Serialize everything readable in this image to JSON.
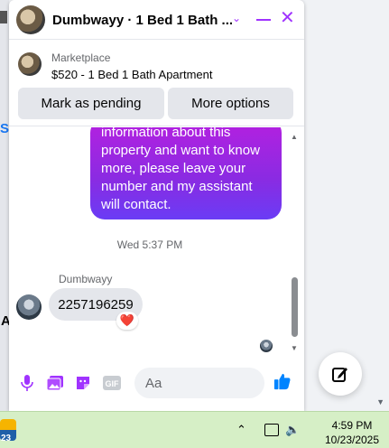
{
  "chat": {
    "title": "Dumbwayy · 1 Bed 1 Bath ...",
    "marketplace_label": "Marketplace",
    "listing_title": "$520 - 1 Bed 1 Bath Apartment",
    "mark_pending_label": "Mark as pending",
    "more_options_label": "More options"
  },
  "conversation": {
    "outgoing_text": "information about this property and want to know more, please leave your number and my assistant will contact.",
    "timestamp": "Wed 5:37 PM",
    "sender_name": "Dumbwayy",
    "incoming_text": "2257196259",
    "reaction": "❤️"
  },
  "composer": {
    "placeholder": "Aa",
    "gif_label": "GIF"
  },
  "background": {
    "left_text_s": "S",
    "left_text_a": "A"
  },
  "taskbar": {
    "weather_num": "23",
    "time": "4:59 PM",
    "date": "10/23/2025"
  },
  "colors": {
    "accent": "#a033ff",
    "bubble_gradient_top": "#b620e0",
    "bubble_gradient_bottom": "#6a3cf5",
    "messenger_blue": "#0084ff",
    "taskbar": "#d6efc6"
  }
}
